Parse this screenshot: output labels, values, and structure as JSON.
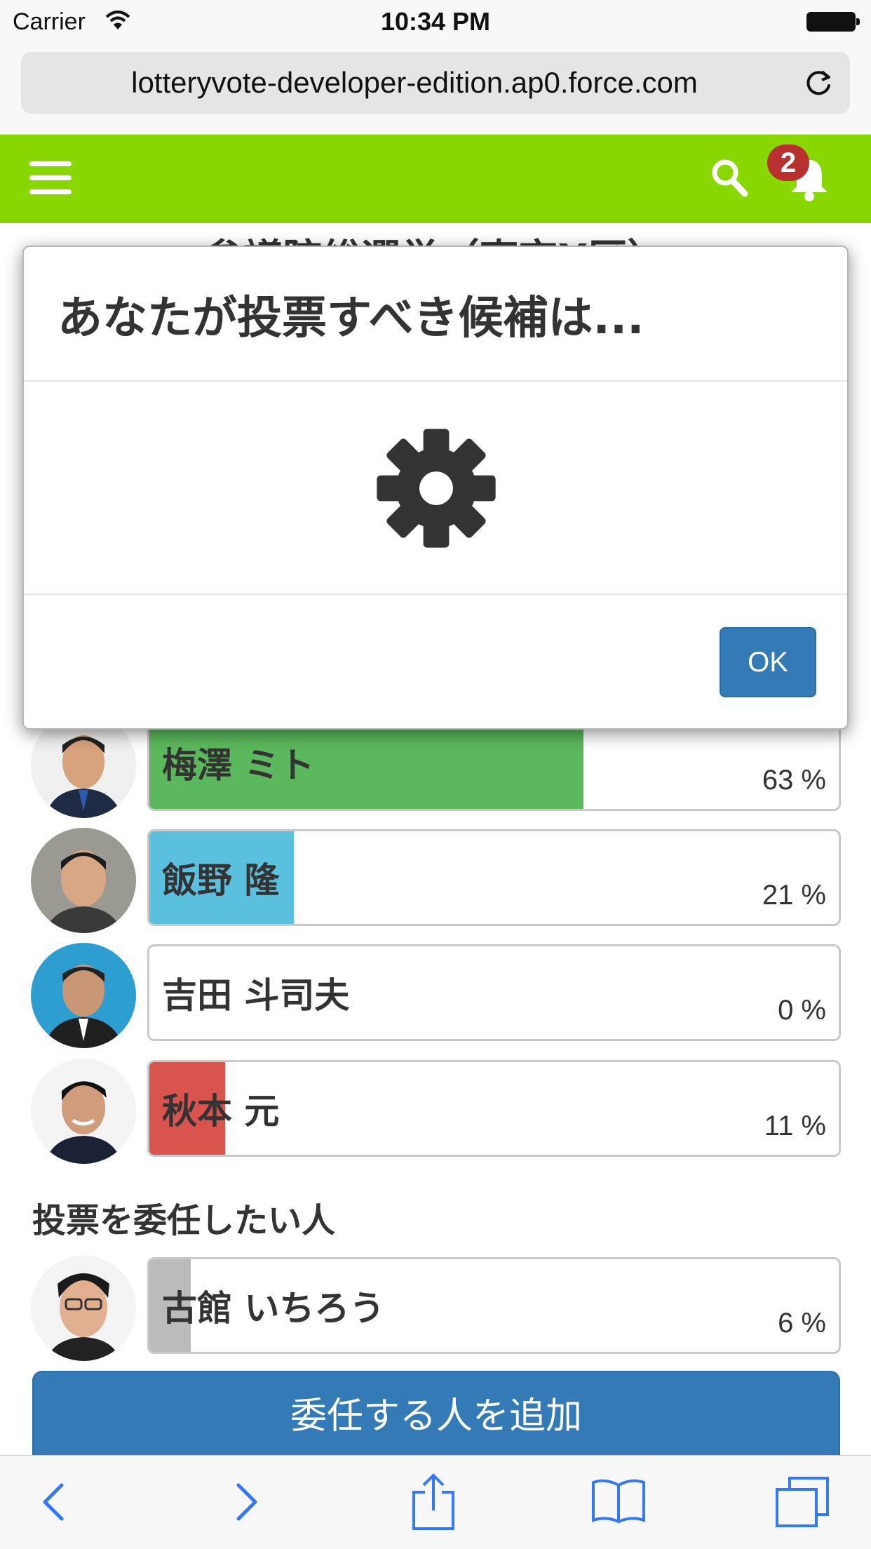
{
  "status_bar": {
    "carrier": "Carrier",
    "time": "10:34 PM"
  },
  "browser": {
    "url": "lotteryvote-developer-edition.ap0.force.com"
  },
  "app_nav": {
    "notification_count": "2"
  },
  "page": {
    "title_partial": "参議院総選挙（東京X区）",
    "candidates": [
      {
        "name": "梅澤 ミト",
        "percent": "63 %",
        "fill": 0.63,
        "color": "#5cb85c"
      },
      {
        "name": "飯野 隆",
        "percent": "21 %",
        "fill": 0.21,
        "color": "#5bc0de"
      },
      {
        "name": "吉田 斗司夫",
        "percent": "0 %",
        "fill": 0.0,
        "color": "#5cb85c"
      },
      {
        "name": "秋本 元",
        "percent": "11 %",
        "fill": 0.11,
        "color": "#d9534f"
      }
    ],
    "delegate_section_label": "投票を委任したい人",
    "delegates": [
      {
        "name": "古館 いちろう",
        "percent": "6 %",
        "fill": 0.06,
        "color": "#bbbbbb"
      }
    ],
    "add_delegate_button": "委任する人を追加"
  },
  "modal": {
    "title": "あなたが投票すべき候補は...",
    "ok_button": "OK",
    "icon": "gear-icon"
  },
  "toolbar": {
    "icons": [
      "back-icon",
      "forward-icon",
      "share-icon",
      "bookmarks-icon",
      "tabs-icon"
    ]
  }
}
